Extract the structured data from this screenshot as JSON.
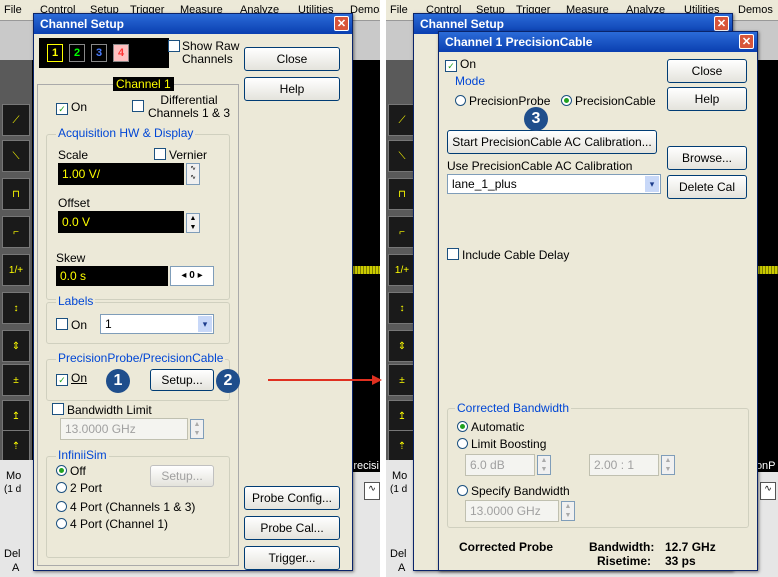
{
  "left_app": {
    "menu": [
      "File",
      "Control",
      "Setup",
      "Trigger",
      "Measure",
      "Analyze",
      "Utilities",
      "Demos"
    ],
    "bottom": {
      "mode_label": "Mo",
      "mode_sub": "(1 d",
      "del_label": "Del",
      "del_sub": "A",
      "precision_text": "Precisi"
    }
  },
  "right_app": {
    "menu": [
      "File",
      "Control",
      "Setup",
      "Trigger",
      "Measure",
      "Analyze",
      "Utilities",
      "Demos"
    ],
    "bottom": {
      "mode_label": "Mo",
      "mode_sub": "(1 d",
      "del_label": "Del",
      "del_sub": "A",
      "precision_text": "sionP"
    }
  },
  "channel_setup": {
    "title": "Channel Setup",
    "channels": [
      "1",
      "2",
      "3",
      "4"
    ],
    "channel_colors": [
      "#ffff00",
      "#00ff00",
      "#4a7dff",
      "#ff3333"
    ],
    "show_raw_label": "Show Raw Channels",
    "close_label": "Close",
    "help_label": "Help",
    "channel_tab": "Channel 1",
    "on_label": "On",
    "differential_label": "Differential Channels 1 & 3",
    "acq_group": "Acquisition HW & Display",
    "scale_label": "Scale",
    "vernier_label": "Vernier",
    "scale_value": "1.00 V/",
    "offset_label": "Offset",
    "offset_value": "0.0 V",
    "skew_label": "Skew",
    "skew_value": "0.0 s",
    "skew_step": "0",
    "labels_group": "Labels",
    "labels_on": "On",
    "labels_value": "1",
    "precision_group": "PrecisionProbe/PrecisionCable",
    "precision_on": "On",
    "setup_label": "Setup...",
    "bandwidth_label": "Bandwidth Limit",
    "bandwidth_value": "13.0000 GHz",
    "infiniisim_group": "InfiniiSim",
    "infiniisim_options": [
      "Off",
      "2 Port",
      "4 Port  (Channels 1 & 3)",
      "4 Port  (Channel 1)"
    ],
    "infiniisim_setup": "Setup...",
    "probe_config": "Probe Config...",
    "probe_cal": "Probe Cal...",
    "trigger": "Trigger..."
  },
  "precision_cable": {
    "title": "Channel 1 PrecisionCable",
    "on_label": "On",
    "mode_group": "Mode",
    "mode_options": [
      "PrecisionProbe",
      "PrecisionCable"
    ],
    "close_label": "Close",
    "help_label": "Help",
    "start_cal": "Start PrecisionCable AC Calibration...",
    "use_cal_label": "Use PrecisionCable AC Calibration",
    "cal_value": "lane_1_plus",
    "browse": "Browse...",
    "delete_cal": "Delete Cal",
    "include_delay": "Include Cable Delay",
    "corrected_group": "Corrected Bandwidth",
    "automatic": "Automatic",
    "limit_boosting": "Limit Boosting",
    "boost_db": "6.0 dB",
    "boost_ratio": "2.00 : 1",
    "specify_bandwidth": "Specify Bandwidth",
    "bandwidth_value": "13.0000 GHz",
    "corrected_probe": "Corrected Probe",
    "bw_label": "Bandwidth:",
    "bw_value": "12.7 GHz",
    "rt_label": "Risetime:",
    "rt_value": "33 ps"
  },
  "callouts": [
    "1",
    "2",
    "3"
  ],
  "accent_colors": {
    "title_blue": "#0a3fb0",
    "group_blue": "#0046d5",
    "badge": "#1f4e8c",
    "arrow": "#e03020",
    "waveform": "#cccc00"
  }
}
